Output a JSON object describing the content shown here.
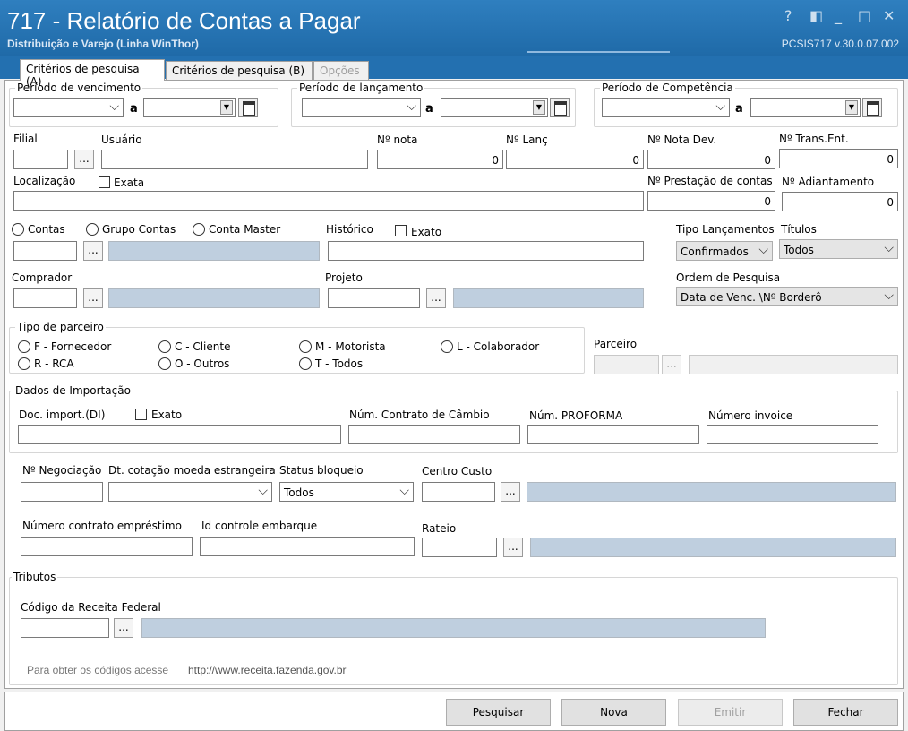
{
  "window": {
    "title": "717 - Relatório de Contas a Pagar",
    "subtitle": "Distribuição e Varejo (Linha WinThor)",
    "version": "PCSIS717 v.30.0.07.002",
    "controls": {
      "help": "?",
      "minimize": "_",
      "maximize": "□",
      "close": "✕"
    }
  },
  "tabs": [
    {
      "label": "Critérios de pesquisa (A)",
      "state": "active"
    },
    {
      "label": "Critérios de pesquisa (B)",
      "state": "normal"
    },
    {
      "label": "Opções",
      "state": "disabled"
    }
  ],
  "periods": {
    "vencimento": "Período de vencimento",
    "lancamento": "Período de lançamento",
    "competencia": "Período de Competência",
    "a": "a"
  },
  "fields": {
    "filial": "Filial",
    "usuario": "Usuário",
    "nota": {
      "label": "Nº nota",
      "value": "0"
    },
    "lanc": {
      "label": "Nº Lanç",
      "value": "0"
    },
    "nota_dev": {
      "label": "Nº Nota Dev.",
      "value": "0"
    },
    "trans_ent": {
      "label": "Nº Trans.Ent.",
      "value": "0"
    },
    "localizacao": "Localização",
    "exata": "Exata",
    "prestacao": {
      "label": "Nº Prestação de contas",
      "value": "0"
    },
    "adiantamento": {
      "label": "Nº Adiantamento",
      "value": "0"
    },
    "contas": "Contas",
    "grupo_contas": "Grupo Contas",
    "conta_master": "Conta Master",
    "historico": "Histórico",
    "exato": "Exato",
    "tipo_lanc": {
      "label": "Tipo Lançamentos",
      "value": "Confirmados"
    },
    "titulos": {
      "label": "Títulos",
      "value": "Todos"
    },
    "comprador": "Comprador",
    "projeto": "Projeto",
    "ordem": {
      "label": "Ordem de Pesquisa",
      "value": "Data de Venc. \\Nº Borderô"
    },
    "ellipsis": "..."
  },
  "parceiro": {
    "group": "Tipo de parceiro",
    "options": [
      "F - Fornecedor",
      "C - Cliente",
      "M - Motorista",
      "L - Colaborador",
      "R - RCA",
      "O - Outros",
      "T - Todos"
    ],
    "label": "Parceiro"
  },
  "importacao": {
    "group": "Dados de Importação",
    "doc": "Doc. import.(DI)",
    "exato": "Exato",
    "contrato_cambio": "Núm. Contrato de Câmbio",
    "proforma": "Núm. PROFORMA",
    "invoice": "Número invoice"
  },
  "extra": {
    "negociacao": "Nº Negociação",
    "cotacao": "Dt. cotação moeda estrangeira",
    "status": {
      "label": "Status bloqueio",
      "value": "Todos"
    },
    "centro_custo": "Centro Custo",
    "contrato_emprestimo": "Número contrato empréstimo",
    "controle_embarque": "Id controle embarque",
    "rateio": "Rateio"
  },
  "tributos": {
    "group": "Tributos",
    "receita": "Código da Receita Federal",
    "hint": "Para obter os códigos acesse",
    "link": "http://www.receita.fazenda.gov.br"
  },
  "buttons": {
    "pesquisar": "Pesquisar",
    "nova": "Nova",
    "emitir": "Emitir",
    "fechar": "Fechar"
  }
}
